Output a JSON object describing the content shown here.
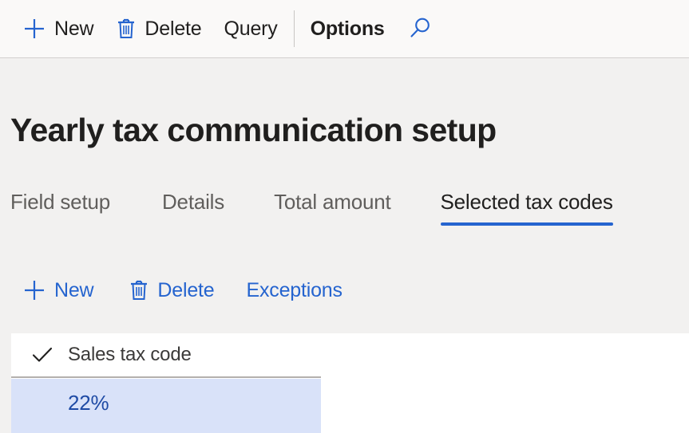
{
  "colors": {
    "accent_blue": "#2564cf",
    "page_background": "#f2f1f0",
    "toolbar_background": "#faf9f8",
    "grid_background": "#ffffff",
    "row_selected_background": "#d9e2f9",
    "row_selected_text": "#1f4ba5",
    "text_primary": "#201f1e",
    "text_secondary": "#605e5c"
  },
  "toolbar": {
    "items": [
      {
        "label": "New",
        "icon": "plus-icon",
        "bold": false
      },
      {
        "label": "Delete",
        "icon": "trash-icon",
        "bold": false
      },
      {
        "label": "Query",
        "icon": null,
        "bold": false
      },
      {
        "label": "Options",
        "icon": null,
        "bold": true
      }
    ],
    "search_icon": "search-icon"
  },
  "page": {
    "title": "Yearly tax communication setup"
  },
  "tabs": [
    {
      "label": "Field setup",
      "active": false
    },
    {
      "label": "Details",
      "active": false
    },
    {
      "label": "Total amount",
      "active": false
    },
    {
      "label": "Selected tax codes",
      "active": true
    }
  ],
  "actionbar": {
    "items": [
      {
        "label": "New",
        "icon": "plus-icon"
      },
      {
        "label": "Delete",
        "icon": "trash-icon"
      },
      {
        "label": "Exceptions",
        "icon": null
      }
    ]
  },
  "grid": {
    "check_icon": "checkmark-icon",
    "columns": [
      "Sales tax code"
    ],
    "rows": [
      {
        "sales_tax_code": "22%",
        "selected": true
      }
    ]
  }
}
